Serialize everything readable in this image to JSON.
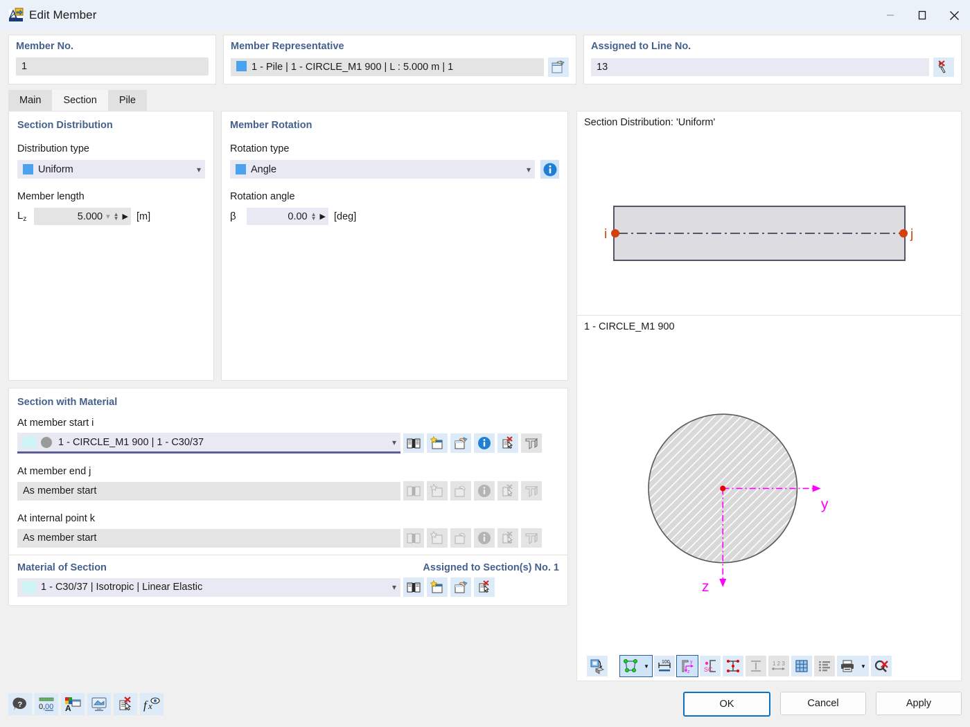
{
  "window": {
    "title": "Edit Member",
    "icon": "member-app-icon",
    "minimize": "minimize-icon",
    "maximize": "maximize-icon",
    "close": "close-icon"
  },
  "header": {
    "member_no": {
      "label": "Member No.",
      "value": "1"
    },
    "member_representative": {
      "label": "Member Representative",
      "value": "1 - Pile | 1 - CIRCLE_M1 900 | L : 5.000 m | 1",
      "pick_icon": "select-in-model-icon"
    },
    "assigned_to_line": {
      "label": "Assigned to Line No.",
      "value": "13",
      "clear_icon": "deselect-icon"
    }
  },
  "tabs": [
    {
      "label": "Main",
      "active": false
    },
    {
      "label": "Section",
      "active": true
    },
    {
      "label": "Pile",
      "active": false
    }
  ],
  "section_distribution": {
    "title": "Section Distribution",
    "distribution_type_label": "Distribution type",
    "distribution_type_value": "Uniform",
    "member_length_label": "Member length",
    "length_symbol": "L",
    "length_symbol_sub": "z",
    "length_value": "5.000",
    "length_unit": "[m]"
  },
  "member_rotation": {
    "title": "Member Rotation",
    "rotation_type_label": "Rotation type",
    "rotation_type_value": "Angle",
    "info_icon": "info-icon",
    "rotation_angle_label": "Rotation angle",
    "angle_symbol": "β",
    "angle_value": "0.00",
    "angle_unit": "[deg]"
  },
  "section_with_material": {
    "title": "Section with Material",
    "rows": [
      {
        "label": "At member start i",
        "value": "1 - CIRCLE_M1 900 | 1 - C30/37",
        "active": true
      },
      {
        "label": "At member end j",
        "value": "As member start",
        "active": false
      },
      {
        "label": "At internal point k",
        "value": "As member start",
        "active": false
      }
    ],
    "row_icons": [
      "library-icon",
      "new-icon",
      "import-icon",
      "info-icon",
      "delete-icon",
      "section-profile-icon"
    ]
  },
  "material_of_section": {
    "title": "Material of Section",
    "assigned_label": "Assigned to Section(s) No. 1",
    "value": "1 - C30/37 | Isotropic | Linear Elastic",
    "icons": [
      "library-icon",
      "new-icon",
      "import-icon",
      "delete-icon"
    ]
  },
  "preview": {
    "distribution_caption": "Section Distribution: 'Uniform'",
    "node_i": "i",
    "node_j": "j",
    "section_caption": "1 - CIRCLE_M1 900",
    "axis_y": "y",
    "axis_z": "z",
    "toolbar": [
      {
        "name": "rotate-view-icon",
        "state": "on"
      },
      {
        "name": "shape-fill-dropdown-icon",
        "state": "selected"
      },
      {
        "name": "dimensions-icon",
        "state": "on"
      },
      {
        "name": "principal-axes-icon",
        "state": "selected"
      },
      {
        "name": "shear-center-icon",
        "state": "on"
      },
      {
        "name": "stress-points-icon",
        "state": "on"
      },
      {
        "name": "section-parts-icon",
        "state": "off"
      },
      {
        "name": "numbering-icon",
        "state": "off"
      },
      {
        "name": "grid-icon",
        "state": "on"
      },
      {
        "name": "table-list-icon",
        "state": "off"
      },
      {
        "name": "print-dropdown-icon",
        "state": "on"
      },
      {
        "name": "zoom-reset-icon",
        "state": "on"
      }
    ]
  },
  "footer": {
    "tools": [
      "help-icon",
      "decimal-places-icon",
      "display-properties-icon",
      "rendering-icon",
      "delete-icon",
      "formula-icon"
    ],
    "buttons": {
      "ok": "OK",
      "cancel": "Cancel",
      "apply": "Apply"
    }
  },
  "colors": {
    "accent_heading": "#44618e",
    "title_bar": "#eaf1f8",
    "swatch_blue": "#4aa3ef",
    "active_underline": "#5b5ba0",
    "node_red": "#d5400c",
    "axis_magenta": "#ff00ff",
    "ok_border": "#0a72c4"
  }
}
